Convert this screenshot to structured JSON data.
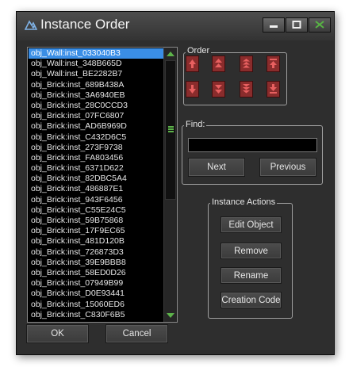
{
  "window": {
    "title": "Instance Order"
  },
  "title_icon": "gamemaker-logo-icon",
  "controls": [
    "minimize-icon",
    "maximize-icon",
    "close-icon"
  ],
  "colors": {
    "selection": "#3a8ee6",
    "order_button": "#8a2c2c",
    "scroll_arrow": "#5db34a"
  },
  "instances": {
    "selected_index": 0,
    "items": [
      "obj_Wall:inst_033040B3",
      "obj_Wall:inst_348B665D",
      "obj_Wall:inst_BE2282B7",
      "obj_Brick:inst_689B438A",
      "obj_Brick:inst_3A6940EB",
      "obj_Brick:inst_28C0CCD3",
      "obj_Brick:inst_07FC6807",
      "obj_Brick:inst_AD6B969D",
      "obj_Brick:inst_C432D6C5",
      "obj_Brick:inst_273F9738",
      "obj_Brick:inst_FA803456",
      "obj_Brick:inst_6371D622",
      "obj_Brick:inst_82DBC5A4",
      "obj_Brick:inst_486887E1",
      "obj_Brick:inst_943F6456",
      "obj_Brick:inst_C55E24C5",
      "obj_Brick:inst_59B75868",
      "obj_Brick:inst_17F9EC65",
      "obj_Brick:inst_481D120B",
      "obj_Brick:inst_726873D3",
      "obj_Brick:inst_39E9BBB8",
      "obj_Brick:inst_58ED0D26",
      "obj_Brick:inst_07949B99",
      "obj_Brick:inst_D0E93441",
      "obj_Brick:inst_15060ED6",
      "obj_Brick:inst_C830F6B5"
    ]
  },
  "order": {
    "label": "Order",
    "buttons": [
      "move-up-one-icon",
      "move-up-fast-icon",
      "move-up-faster-icon",
      "move-to-top-icon",
      "move-down-one-icon",
      "move-down-fast-icon",
      "move-down-faster-icon",
      "move-to-bottom-icon"
    ]
  },
  "find": {
    "label": "Find:",
    "value": "",
    "next": "Next",
    "previous": "Previous"
  },
  "actions": {
    "label": "Instance Actions",
    "edit_object": "Edit Object",
    "remove": "Remove",
    "rename": "Rename",
    "creation_code": "Creation Code"
  },
  "footer": {
    "ok": "OK",
    "cancel": "Cancel"
  }
}
